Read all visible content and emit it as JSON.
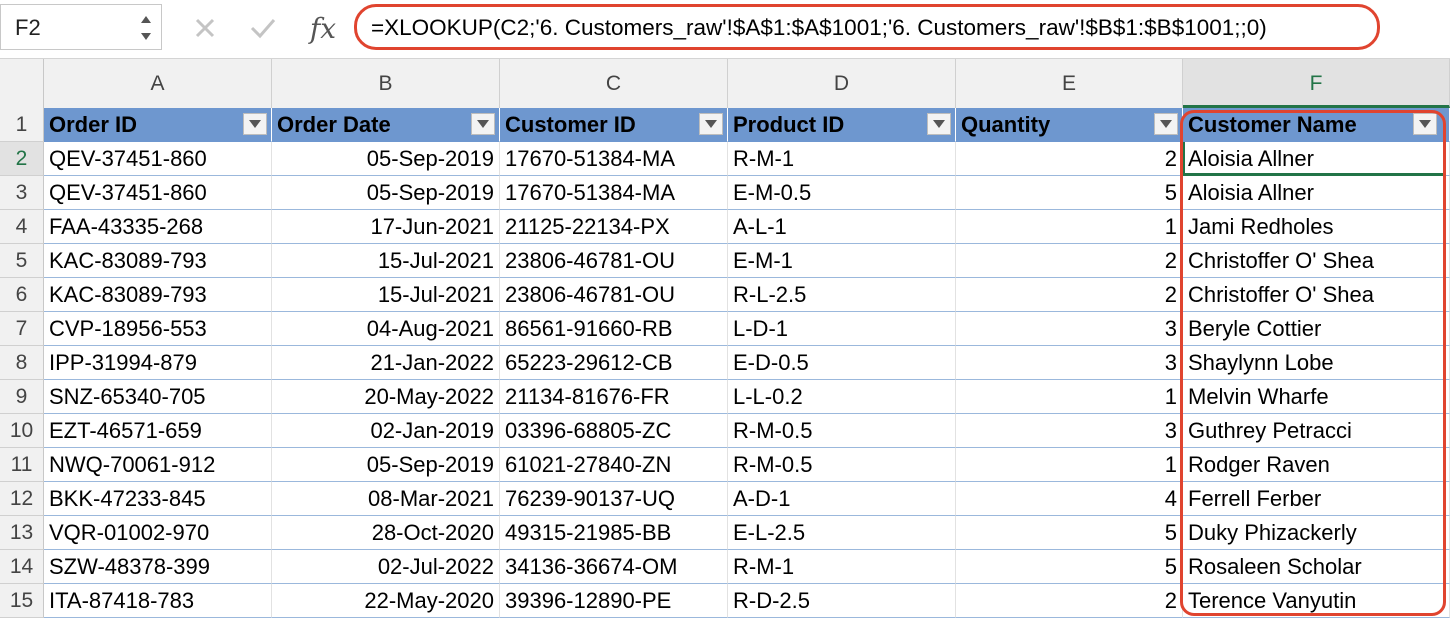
{
  "name_box": {
    "value": "F2"
  },
  "formula_bar": {
    "fx_label": "fx",
    "formula": "=XLOOKUP(C2;'6. Customers_raw'!$A$1:$A$1001;'6. Customers_raw'!$B$1:$B$1001;;0)"
  },
  "icons": {
    "cancel": "close-icon",
    "confirm": "checkmark-icon",
    "stepper": "stepper-arrows-icon",
    "filter": "filter-dropdown-icon"
  },
  "colors": {
    "header_fill": "#6e97cf",
    "accent_green": "#227447",
    "highlight_red": "#e0442f"
  },
  "grid": {
    "columns": [
      "A",
      "B",
      "C",
      "D",
      "E",
      "F"
    ],
    "active_column": "F",
    "headers": [
      "Order ID",
      "Order Date",
      "Customer ID",
      "Product ID",
      "Quantity",
      "Customer Name"
    ],
    "rows": [
      {
        "num": "2",
        "cells": [
          "QEV-37451-860",
          "05-Sep-2019",
          "17670-51384-MA",
          "R-M-1",
          "2",
          "Aloisia Allner"
        ]
      },
      {
        "num": "3",
        "cells": [
          "QEV-37451-860",
          "05-Sep-2019",
          "17670-51384-MA",
          "E-M-0.5",
          "5",
          "Aloisia Allner"
        ]
      },
      {
        "num": "4",
        "cells": [
          "FAA-43335-268",
          "17-Jun-2021",
          "21125-22134-PX",
          "A-L-1",
          "1",
          "Jami Redholes"
        ]
      },
      {
        "num": "5",
        "cells": [
          "KAC-83089-793",
          "15-Jul-2021",
          "23806-46781-OU",
          "E-M-1",
          "2",
          "Christoffer O' Shea"
        ]
      },
      {
        "num": "6",
        "cells": [
          "KAC-83089-793",
          "15-Jul-2021",
          "23806-46781-OU",
          "R-L-2.5",
          "2",
          "Christoffer O' Shea"
        ]
      },
      {
        "num": "7",
        "cells": [
          "CVP-18956-553",
          "04-Aug-2021",
          "86561-91660-RB",
          "L-D-1",
          "3",
          "Beryle Cottier"
        ]
      },
      {
        "num": "8",
        "cells": [
          "IPP-31994-879",
          "21-Jan-2022",
          "65223-29612-CB",
          "E-D-0.5",
          "3",
          "Shaylynn Lobe"
        ]
      },
      {
        "num": "9",
        "cells": [
          "SNZ-65340-705",
          "20-May-2022",
          "21134-81676-FR",
          "L-L-0.2",
          "1",
          "Melvin Wharfe"
        ]
      },
      {
        "num": "10",
        "cells": [
          "EZT-46571-659",
          "02-Jan-2019",
          "03396-68805-ZC",
          "R-M-0.5",
          "3",
          "Guthrey Petracci"
        ]
      },
      {
        "num": "11",
        "cells": [
          "NWQ-70061-912",
          "05-Sep-2019",
          "61021-27840-ZN",
          "R-M-0.5",
          "1",
          "Rodger Raven"
        ]
      },
      {
        "num": "12",
        "cells": [
          "BKK-47233-845",
          "08-Mar-2021",
          "76239-90137-UQ",
          "A-D-1",
          "4",
          "Ferrell Ferber"
        ]
      },
      {
        "num": "13",
        "cells": [
          "VQR-01002-970",
          "28-Oct-2020",
          "49315-21985-BB",
          "E-L-2.5",
          "5",
          "Duky Phizackerly"
        ]
      },
      {
        "num": "14",
        "cells": [
          "SZW-48378-399",
          "02-Jul-2022",
          "34136-36674-OM",
          "R-M-1",
          "5",
          "Rosaleen Scholar"
        ]
      },
      {
        "num": "15",
        "cells": [
          "ITA-87418-783",
          "22-May-2020",
          "39396-12890-PE",
          "R-D-2.5",
          "2",
          "Terence Vanyutin"
        ]
      }
    ]
  }
}
